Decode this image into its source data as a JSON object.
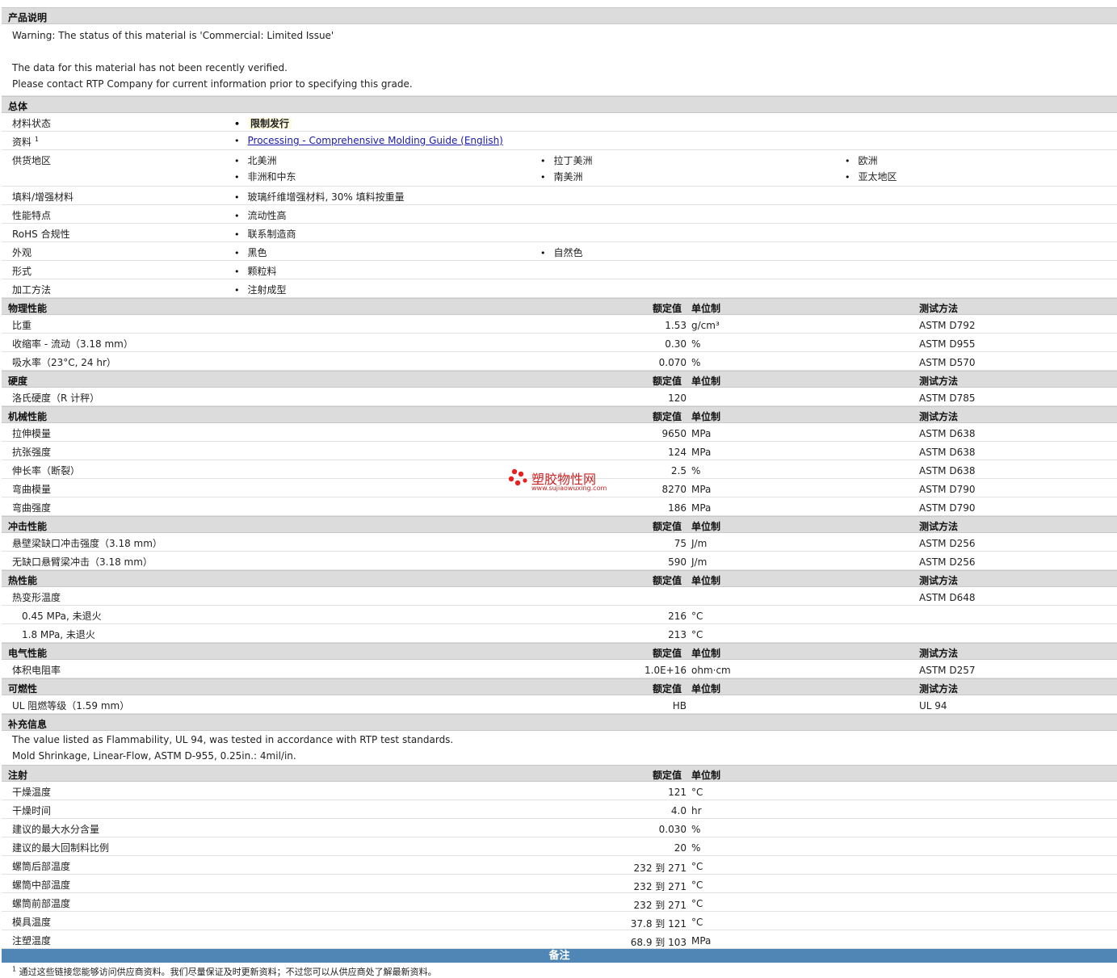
{
  "description": {
    "title": "产品说明",
    "lines": [
      "Warning: The status of this material is 'Commercial: Limited Issue'",
      "",
      "The data for this material has not been recently verified.",
      "Please contact RTP Company for current information prior to specifying this grade."
    ]
  },
  "general": {
    "title": "总体",
    "status_label": "材料状态",
    "status_value": "限制发行",
    "docs_label": "资料",
    "docs_sup": "1",
    "docs_link": "Processing - Comprehensive Molding Guide (English)",
    "region_label": "供货地区",
    "regions": [
      "北美洲",
      "拉丁美洲",
      "欧洲",
      "非洲和中东",
      "南美洲",
      "亚太地区"
    ],
    "filler_label": "填料/增强材料",
    "filler_value": "玻璃纤维增强材料, 30% 填料按重量",
    "feature_label": "性能特点",
    "feature_value": "流动性高",
    "rohs_label": "RoHS 合规性",
    "rohs_value": "联系制造商",
    "look_label": "外观",
    "look_values": [
      "黑色",
      "自然色"
    ],
    "form_label": "形式",
    "form_value": "颗粒料",
    "process_label": "加工方法",
    "process_value": "注射成型"
  },
  "headers": {
    "nominal": "额定值",
    "unit": "单位制",
    "method": "测试方法"
  },
  "physical": {
    "title": "物理性能",
    "rows": [
      {
        "label": "比重",
        "value": "1.53",
        "unit": "g/cm³",
        "method": "ASTM D792"
      },
      {
        "label": "收缩率 - 流动（3.18 mm）",
        "value": "0.30",
        "unit": "%",
        "method": "ASTM D955"
      },
      {
        "label": "吸水率（23°C, 24 hr）",
        "value": "0.070",
        "unit": "%",
        "method": "ASTM D570"
      }
    ]
  },
  "hardness": {
    "title": "硬度",
    "rows": [
      {
        "label": "洛氏硬度（R 计秤）",
        "value": "120",
        "unit": "",
        "method": "ASTM D785"
      }
    ]
  },
  "mechanical": {
    "title": "机械性能",
    "rows": [
      {
        "label": "拉伸模量",
        "value": "9650",
        "unit": "MPa",
        "method": "ASTM D638"
      },
      {
        "label": "抗张强度",
        "value": "124",
        "unit": "MPa",
        "method": "ASTM D638"
      },
      {
        "label": "伸长率（断裂）",
        "value": "2.5",
        "unit": "%",
        "method": "ASTM D638"
      },
      {
        "label": "弯曲模量",
        "value": "8270",
        "unit": "MPa",
        "method": "ASTM D790"
      },
      {
        "label": "弯曲强度",
        "value": "186",
        "unit": "MPa",
        "method": "ASTM D790"
      }
    ]
  },
  "impact": {
    "title": "冲击性能",
    "rows": [
      {
        "label": "悬壁梁缺口冲击强度（3.18 mm）",
        "value": "75",
        "unit": "J/m",
        "method": "ASTM D256"
      },
      {
        "label": "无缺口悬臂梁冲击（3.18 mm）",
        "value": "590",
        "unit": "J/m",
        "method": "ASTM D256"
      }
    ]
  },
  "thermal": {
    "title": "热性能",
    "rows": [
      {
        "label": "热变形温度",
        "value": "",
        "unit": "",
        "method": "ASTM D648",
        "sub": false
      },
      {
        "label": "0.45 MPa, 未退火",
        "value": "216",
        "unit": "°C",
        "method": "",
        "sub": true
      },
      {
        "label": "1.8 MPa, 未退火",
        "value": "213",
        "unit": "°C",
        "method": "",
        "sub": true
      }
    ]
  },
  "electrical": {
    "title": "电气性能",
    "rows": [
      {
        "label": "体积电阻率",
        "value": "1.0E+16",
        "unit": "ohm·cm",
        "method": "ASTM D257"
      }
    ]
  },
  "flammability": {
    "title": "可燃性",
    "rows": [
      {
        "label": "UL 阻燃等级（1.59 mm）",
        "value": "HB",
        "unit": "",
        "method": "UL 94"
      }
    ]
  },
  "supplement": {
    "title": "补充信息",
    "lines": [
      "The value listed as Flammability, UL 94, was tested in accordance with RTP test standards.",
      "Mold Shrinkage, Linear-Flow, ASTM D-955, 0.25in.: 4mil/in."
    ]
  },
  "injection": {
    "title": "注射",
    "rows": [
      {
        "label": "干燥温度",
        "value": "121",
        "unit": "°C"
      },
      {
        "label": "干燥时间",
        "value": "4.0",
        "unit": "hr"
      },
      {
        "label": "建议的最大水分含量",
        "value": "0.030",
        "unit": "%"
      },
      {
        "label": "建议的最大回制料比例",
        "value": "20",
        "unit": "%"
      },
      {
        "label": "螺筒后部温度",
        "value": "232 到  271",
        "unit": "°C"
      },
      {
        "label": "螺筒中部温度",
        "value": "232 到  271",
        "unit": "°C"
      },
      {
        "label": "螺筒前部温度",
        "value": "232 到  271",
        "unit": "°C"
      },
      {
        "label": "模具温度",
        "value": "37.8 到  121",
        "unit": "°C"
      },
      {
        "label": "注塑温度",
        "value": "68.9 到  103",
        "unit": "MPa"
      }
    ]
  },
  "notes": {
    "title": "备注",
    "footnote_sup": "1",
    "footnote": "通过这些链接您能够访问供应商资料。我们尽量保证及时更新资料；不过您可以从供应商处了解最新资料。"
  },
  "watermark": {
    "text": "塑胶物性网",
    "url": "www.sujiaowuxing.com"
  },
  "colors": {
    "section_bg": "#dcdcdc",
    "notes_bar": "#4f86b6",
    "link": "#1a1aaa",
    "watermark": "#cc2222"
  }
}
